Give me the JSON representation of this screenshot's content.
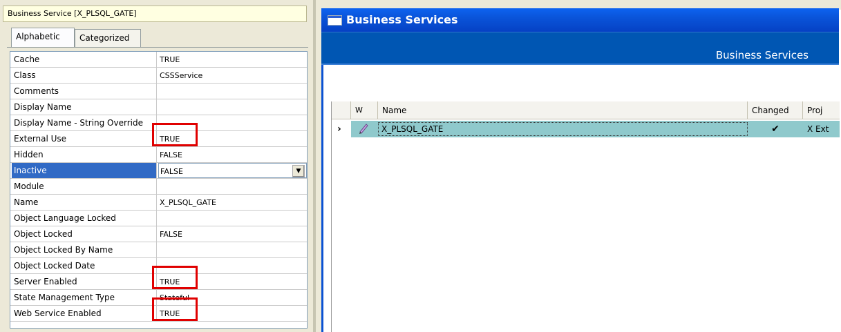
{
  "properties": {
    "title": "Business Service [X_PLSQL_GATE]",
    "tabs": [
      "Alphabetic",
      "Categorized"
    ],
    "rows": [
      {
        "name": "Cache",
        "value": "TRUE"
      },
      {
        "name": "Class",
        "value": "CSSService"
      },
      {
        "name": "Comments",
        "value": ""
      },
      {
        "name": "Display Name",
        "value": ""
      },
      {
        "name": "Display Name - String Override",
        "value": ""
      },
      {
        "name": "External Use",
        "value": "TRUE"
      },
      {
        "name": "Hidden",
        "value": "FALSE"
      },
      {
        "name": "Inactive",
        "value": "FALSE"
      },
      {
        "name": "Module",
        "value": ""
      },
      {
        "name": "Name",
        "value": "X_PLSQL_GATE"
      },
      {
        "name": "Object Language Locked",
        "value": ""
      },
      {
        "name": "Object Locked",
        "value": "FALSE"
      },
      {
        "name": "Object Locked By Name",
        "value": ""
      },
      {
        "name": "Object Locked Date",
        "value": ""
      },
      {
        "name": "Server Enabled",
        "value": "TRUE"
      },
      {
        "name": "State Management Type",
        "value": "Stateful"
      },
      {
        "name": "Web Service Enabled",
        "value": "TRUE"
      }
    ],
    "selected_row": "Inactive",
    "highlighted_rows": [
      "External Use",
      "Server Enabled",
      "Web Service Enabled"
    ],
    "highlight_color": "#e00000"
  },
  "business_services": {
    "window_title": "Business Services",
    "header_label": "Business Services",
    "columns": [
      "W",
      "Name",
      "Changed",
      "Proj"
    ],
    "rows": [
      {
        "w_icon": "pencil-icon",
        "name": "X_PLSQL_GATE",
        "changed": "✔",
        "project": "X Ext"
      }
    ],
    "row_color": "#8fc9cc"
  }
}
